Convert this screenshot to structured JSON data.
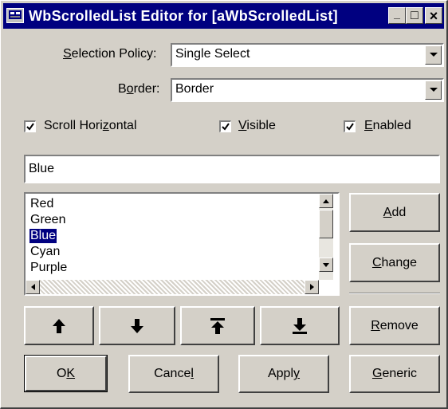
{
  "window": {
    "title": "WbScrolledList Editor for [aWbScrolledList]",
    "minimize_glyph": "_",
    "maximize_glyph": "□",
    "close_glyph": "×"
  },
  "selection_policy": {
    "label_pre": "",
    "label_hot": "S",
    "label_post": "election Policy:",
    "value": "Single Select"
  },
  "border": {
    "label_pre": "B",
    "label_hot": "o",
    "label_post": "rder:",
    "value": "Border"
  },
  "checkboxes": {
    "scroll_horizontal": {
      "pre": "Scroll Hori",
      "hot": "z",
      "post": "ontal",
      "checked": true
    },
    "visible": {
      "pre": "",
      "hot": "V",
      "post": "isible",
      "checked": true
    },
    "enabled": {
      "pre": "",
      "hot": "E",
      "post": "nabled",
      "checked": true
    }
  },
  "item_field": {
    "value": "Blue"
  },
  "list": {
    "items": [
      "Red",
      "Green",
      "Blue",
      "Cyan",
      "Purple"
    ],
    "selected": "Blue"
  },
  "side_buttons": {
    "add": {
      "pre": "",
      "hot": "A",
      "post": "dd"
    },
    "change": {
      "pre": "",
      "hot": "C",
      "post": "hange"
    },
    "remove": {
      "pre": "",
      "hot": "R",
      "post": "emove"
    }
  },
  "move_buttons": [
    "move-up",
    "move-down",
    "move-to-top",
    "move-to-bottom"
  ],
  "bottom_buttons": {
    "ok": {
      "pre": "O",
      "hot": "K",
      "post": ""
    },
    "cancel": {
      "pre": "Cance",
      "hot": "l",
      "post": ""
    },
    "apply": {
      "pre": "Appl",
      "hot": "y",
      "post": ""
    },
    "generic": {
      "pre": "",
      "hot": "G",
      "post": "eneric"
    }
  },
  "colors": {
    "face": "#d4d0c8",
    "title_bar": "#000080",
    "selection": "#000080"
  }
}
